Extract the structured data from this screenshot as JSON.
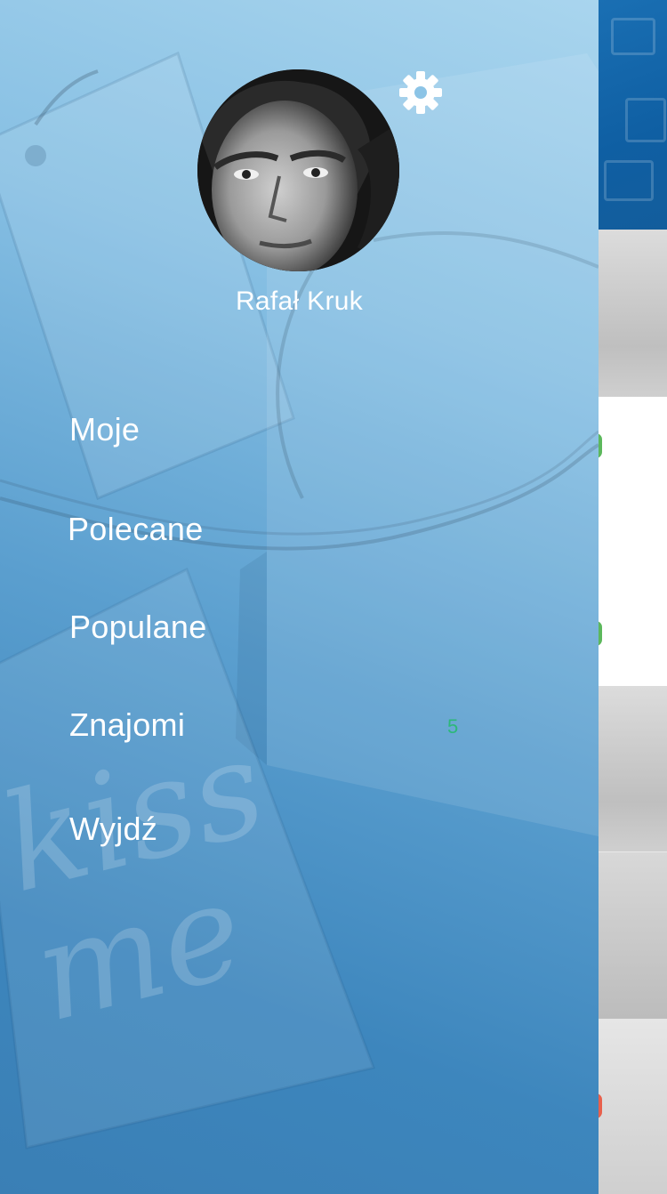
{
  "profile": {
    "name": "Rafał Kruk"
  },
  "menu": {
    "items": [
      {
        "label": "Moje"
      },
      {
        "label": "Polecane"
      },
      {
        "label": "Populane"
      },
      {
        "label": "Znajomi",
        "badge": "5"
      },
      {
        "label": "Wyjdź"
      }
    ]
  },
  "background": {
    "handwriting": "kiss me"
  },
  "colors": {
    "accent_badge": "#2db87a",
    "drawer_top": "#a9d5ee",
    "drawer_bottom": "#3a7fb5",
    "peek_header": "#1a6fb3"
  },
  "icons": {
    "settings": "gear-icon"
  }
}
